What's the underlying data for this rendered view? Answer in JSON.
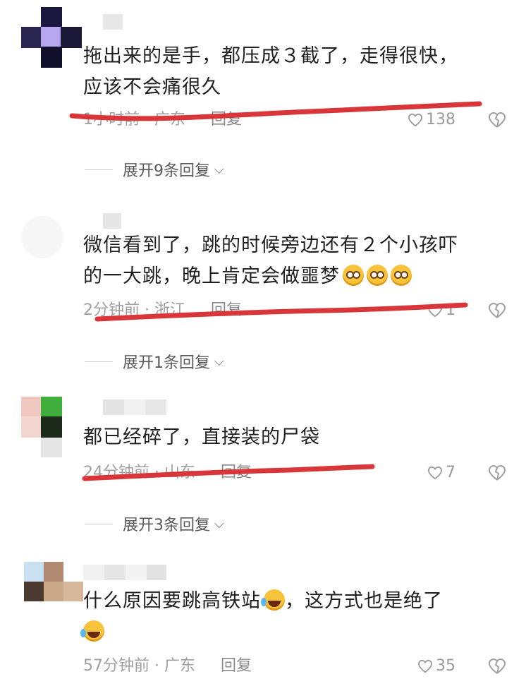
{
  "comments": [
    {
      "text_lines": [
        "拖出来的是手，都压成３截了，走得很快，",
        "应该不会痛很久"
      ],
      "meta": "1小时前 · 广东",
      "reply_label": "回复",
      "likes": "138",
      "expand_label": "展开9条回复"
    },
    {
      "text_lines": [
        "微信看到了，跳的时候旁边还有２个小孩吓",
        "的一大跳，晚上肯定会做噩梦"
      ],
      "meta": "2分钟前 · 浙江",
      "reply_label": "回复",
      "likes": "1",
      "expand_label": "展开1条回复"
    },
    {
      "text_lines": [
        "都已经碎了，直接装的尸袋"
      ],
      "meta": "24分钟前 · 山东",
      "reply_label": "回复",
      "likes": "7",
      "expand_label": "展开3条回复"
    },
    {
      "text_lines": [
        "什么原因要跳高铁站",
        "，这方式也是绝了"
      ],
      "meta": "57分钟前 · 广东",
      "reply_label": "回复",
      "likes": "35"
    }
  ],
  "icons": {
    "like": "heart-outline-icon",
    "dislike": "broken-heart-icon",
    "expand": "chevron-down-icon"
  },
  "colors": {
    "annotation_red": "#d9363a",
    "meta_gray": "#a0a0a0"
  }
}
